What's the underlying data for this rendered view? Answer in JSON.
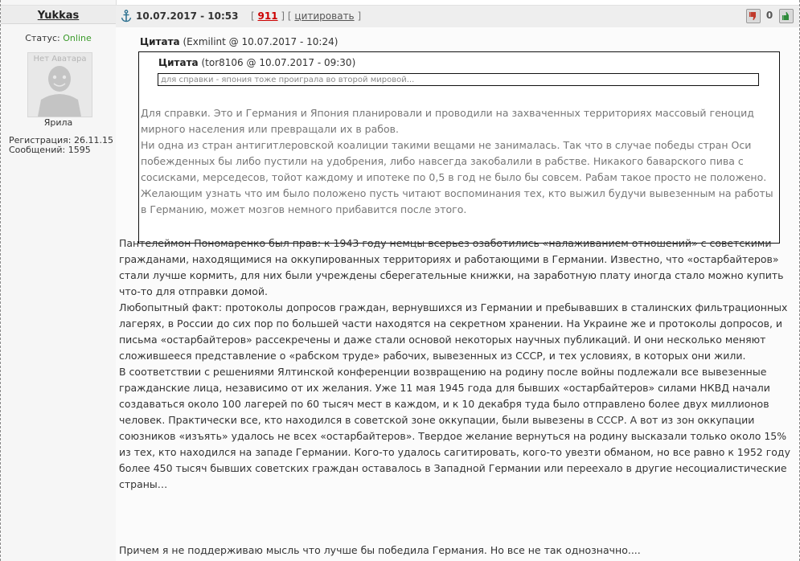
{
  "user": {
    "name": "Yukkas",
    "status_label": "Статус:",
    "status_value": "Online",
    "avatar_text": "Нет Аватара",
    "rank": "Ярила",
    "registration": "Регистрация: 26.11.15",
    "messages": "Сообщений: 1595"
  },
  "header": {
    "icon": "anchor-icon",
    "date": "10.07.2017 - 10:53",
    "bracket_open": "[",
    "post_number": "911",
    "bracket_mid": "] [",
    "quote_label": "цитировать",
    "bracket_close": "]",
    "rating": "0",
    "colors": {
      "post_number": "#cc0000",
      "online": "#3a9a2a"
    }
  },
  "quote": {
    "label": "Цитата",
    "meta": "(Exmilint @ 10.07.2017 - 10:24)",
    "inner_label": "Цитата",
    "inner_meta": "(tor8106 @ 10.07.2017 - 09:30)",
    "inner_text": "для справки - япония тоже проиграла во второй мировой...",
    "body": [
      "Для справки. Это и Германия и Япония планировали и проводили на захваченных территориях массовый геноцид мирного населения или превращали их в рабов.",
      "Ни одна из стран антигитлеровской коалиции такими вещами не занималась. Так что в случае победы стран Оси побежденных бы либо пустили на удобрения, либо навсегда закобалили в рабстве. Никакого баварского пива с сосисками, мерседесов, тойот каждому и ипотеке по 0,5 в год не было бы совсем. Рабам такое просто не положено. Желающим узнать что им было положено пусть читают воспоминания тех, кто выжил будучи вывезенным на работы в Германию, может мозгов немного прибавится после этого."
    ]
  },
  "post": {
    "paragraphs": [
      "Пантелеймон Пономаренко был прав: к 1943 году немцы всерьез озаботились «налаживанием отношений» с советскими гражданами, находящимися на оккупированных территориях и работающими в Германии. Известно, что «остарбайтеров» стали лучше кормить, для них были учреждены сберегательные книжки, на заработную плату иногда стало можно купить что-то для отправки домой.",
      "Любопытный факт: протоколы допросов граждан, вернувшихся из Германии и пребывавших в сталинских фильтрационных лагерях, в России до сих пор по большей части находятся на секретном хранении. На Украине же и протоколы допросов, и письма «остарбайтеров» рассекречены и даже стали основой некоторых научных публикаций. И они несколько меняют сложившееся представление о «рабском труде» рабочих, вывезенных из СССР, и тех условиях, в которых они жили.",
      "В соответствии с решениями Ялтинской конференции возвращению на родину после войны подлежали все вывезенные гражданские лица, независимо от их желания. Уже 11 мая 1945 года для бывших «остарбайтеров» силами НКВД начали создаваться около 100 лагерей по 60 тысяч мест в каждом, и к 10 декабря туда было отправлено более двух миллионов человек. Практически все, кто находился в советской зоне оккупации, были вывезены в СССР. А вот из зон оккупации союзников «изъять» удалось не всех «остарбайтеров». Твердое желание вернуться на родину высказали только около 15% из тех, кто находился на западе Германии. Кого-то удалось сагитировать, кого-то увезти обманом, но все равно к 1952 году более 450 тысяч бывших советских граждан оставалось в Западной Германии или переехало в другие несоциалистические страны…"
    ],
    "closing": "Причем я не поддерживаю мысль что лучше бы победила Германия. Но все не так однозначно...."
  }
}
